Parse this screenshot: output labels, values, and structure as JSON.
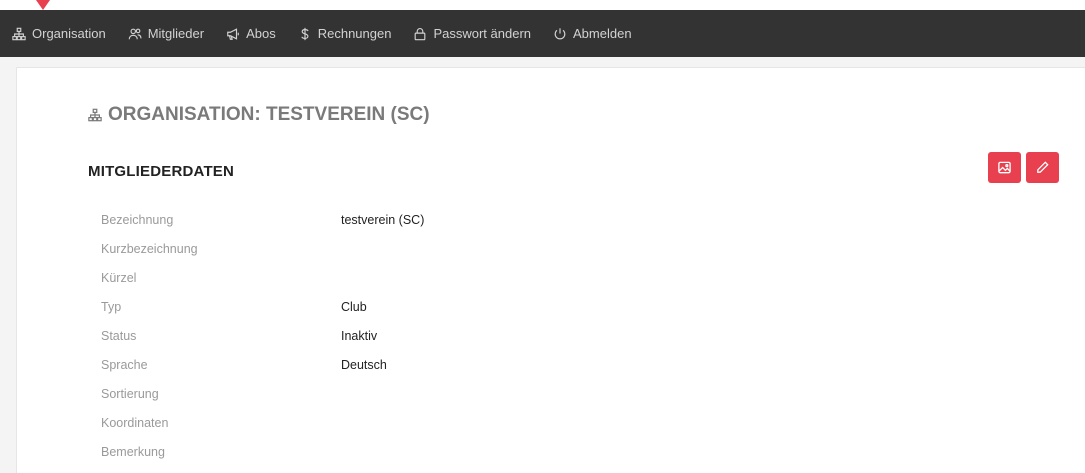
{
  "colors": {
    "accent": "#e8404e",
    "navbar": "#333333",
    "nav_text": "#d2d2d2"
  },
  "nav": {
    "items": [
      {
        "label": "Organisation",
        "icon": "sitemap-icon"
      },
      {
        "label": "Mitglieder",
        "icon": "users-icon"
      },
      {
        "label": "Abos",
        "icon": "megaphone-icon"
      },
      {
        "label": "Rechnungen",
        "icon": "dollar-icon"
      },
      {
        "label": "Passwort ändern",
        "icon": "lock-icon"
      },
      {
        "label": "Abmelden",
        "icon": "power-icon"
      }
    ]
  },
  "page": {
    "title": "ORGANISATION: TESTVEREIN (SC)",
    "title_icon": "sitemap-icon",
    "section_title": "MITGLIEDERDATEN",
    "actions": [
      {
        "icon": "image-icon"
      },
      {
        "icon": "pencil-icon"
      }
    ]
  },
  "fields": [
    {
      "label": "Bezeichnung",
      "value": "testverein (SC)"
    },
    {
      "label": "Kurzbezeichnung",
      "value": ""
    },
    {
      "label": "Kürzel",
      "value": ""
    },
    {
      "label": "Typ",
      "value": "Club"
    },
    {
      "label": "Status",
      "value": "Inaktiv"
    },
    {
      "label": "Sprache",
      "value": "Deutsch"
    },
    {
      "label": "Sortierung",
      "value": ""
    },
    {
      "label": "Koordinaten",
      "value": ""
    },
    {
      "label": "Bemerkung",
      "value": ""
    }
  ]
}
